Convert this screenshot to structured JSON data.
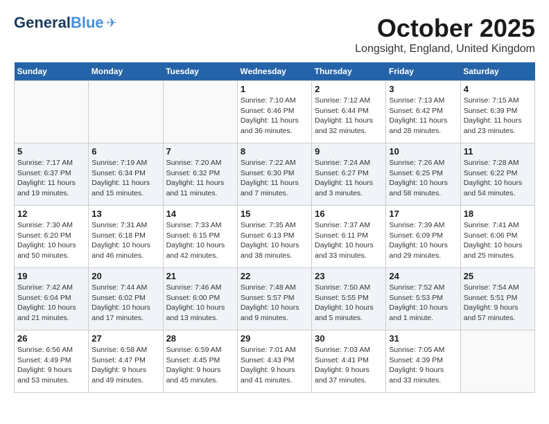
{
  "header": {
    "logo_general": "General",
    "logo_blue": "Blue",
    "month": "October 2025",
    "location": "Longsight, England, United Kingdom"
  },
  "days_of_week": [
    "Sunday",
    "Monday",
    "Tuesday",
    "Wednesday",
    "Thursday",
    "Friday",
    "Saturday"
  ],
  "weeks": [
    [
      {
        "day": "",
        "info": ""
      },
      {
        "day": "",
        "info": ""
      },
      {
        "day": "",
        "info": ""
      },
      {
        "day": "1",
        "info": "Sunrise: 7:10 AM\nSunset: 6:46 PM\nDaylight: 11 hours\nand 36 minutes."
      },
      {
        "day": "2",
        "info": "Sunrise: 7:12 AM\nSunset: 6:44 PM\nDaylight: 11 hours\nand 32 minutes."
      },
      {
        "day": "3",
        "info": "Sunrise: 7:13 AM\nSunset: 6:42 PM\nDaylight: 11 hours\nand 28 minutes."
      },
      {
        "day": "4",
        "info": "Sunrise: 7:15 AM\nSunset: 6:39 PM\nDaylight: 11 hours\nand 23 minutes."
      }
    ],
    [
      {
        "day": "5",
        "info": "Sunrise: 7:17 AM\nSunset: 6:37 PM\nDaylight: 11 hours\nand 19 minutes."
      },
      {
        "day": "6",
        "info": "Sunrise: 7:19 AM\nSunset: 6:34 PM\nDaylight: 11 hours\nand 15 minutes."
      },
      {
        "day": "7",
        "info": "Sunrise: 7:20 AM\nSunset: 6:32 PM\nDaylight: 11 hours\nand 11 minutes."
      },
      {
        "day": "8",
        "info": "Sunrise: 7:22 AM\nSunset: 6:30 PM\nDaylight: 11 hours\nand 7 minutes."
      },
      {
        "day": "9",
        "info": "Sunrise: 7:24 AM\nSunset: 6:27 PM\nDaylight: 11 hours\nand 3 minutes."
      },
      {
        "day": "10",
        "info": "Sunrise: 7:26 AM\nSunset: 6:25 PM\nDaylight: 10 hours\nand 58 minutes."
      },
      {
        "day": "11",
        "info": "Sunrise: 7:28 AM\nSunset: 6:22 PM\nDaylight: 10 hours\nand 54 minutes."
      }
    ],
    [
      {
        "day": "12",
        "info": "Sunrise: 7:30 AM\nSunset: 6:20 PM\nDaylight: 10 hours\nand 50 minutes."
      },
      {
        "day": "13",
        "info": "Sunrise: 7:31 AM\nSunset: 6:18 PM\nDaylight: 10 hours\nand 46 minutes."
      },
      {
        "day": "14",
        "info": "Sunrise: 7:33 AM\nSunset: 6:15 PM\nDaylight: 10 hours\nand 42 minutes."
      },
      {
        "day": "15",
        "info": "Sunrise: 7:35 AM\nSunset: 6:13 PM\nDaylight: 10 hours\nand 38 minutes."
      },
      {
        "day": "16",
        "info": "Sunrise: 7:37 AM\nSunset: 6:11 PM\nDaylight: 10 hours\nand 33 minutes."
      },
      {
        "day": "17",
        "info": "Sunrise: 7:39 AM\nSunset: 6:09 PM\nDaylight: 10 hours\nand 29 minutes."
      },
      {
        "day": "18",
        "info": "Sunrise: 7:41 AM\nSunset: 6:06 PM\nDaylight: 10 hours\nand 25 minutes."
      }
    ],
    [
      {
        "day": "19",
        "info": "Sunrise: 7:42 AM\nSunset: 6:04 PM\nDaylight: 10 hours\nand 21 minutes."
      },
      {
        "day": "20",
        "info": "Sunrise: 7:44 AM\nSunset: 6:02 PM\nDaylight: 10 hours\nand 17 minutes."
      },
      {
        "day": "21",
        "info": "Sunrise: 7:46 AM\nSunset: 6:00 PM\nDaylight: 10 hours\nand 13 minutes."
      },
      {
        "day": "22",
        "info": "Sunrise: 7:48 AM\nSunset: 5:57 PM\nDaylight: 10 hours\nand 9 minutes."
      },
      {
        "day": "23",
        "info": "Sunrise: 7:50 AM\nSunset: 5:55 PM\nDaylight: 10 hours\nand 5 minutes."
      },
      {
        "day": "24",
        "info": "Sunrise: 7:52 AM\nSunset: 5:53 PM\nDaylight: 10 hours\nand 1 minute."
      },
      {
        "day": "25",
        "info": "Sunrise: 7:54 AM\nSunset: 5:51 PM\nDaylight: 9 hours\nand 57 minutes."
      }
    ],
    [
      {
        "day": "26",
        "info": "Sunrise: 6:56 AM\nSunset: 4:49 PM\nDaylight: 9 hours\nand 53 minutes."
      },
      {
        "day": "27",
        "info": "Sunrise: 6:58 AM\nSunset: 4:47 PM\nDaylight: 9 hours\nand 49 minutes."
      },
      {
        "day": "28",
        "info": "Sunrise: 6:59 AM\nSunset: 4:45 PM\nDaylight: 9 hours\nand 45 minutes."
      },
      {
        "day": "29",
        "info": "Sunrise: 7:01 AM\nSunset: 4:43 PM\nDaylight: 9 hours\nand 41 minutes."
      },
      {
        "day": "30",
        "info": "Sunrise: 7:03 AM\nSunset: 4:41 PM\nDaylight: 9 hours\nand 37 minutes."
      },
      {
        "day": "31",
        "info": "Sunrise: 7:05 AM\nSunset: 4:39 PM\nDaylight: 9 hours\nand 33 minutes."
      },
      {
        "day": "",
        "info": ""
      }
    ]
  ]
}
